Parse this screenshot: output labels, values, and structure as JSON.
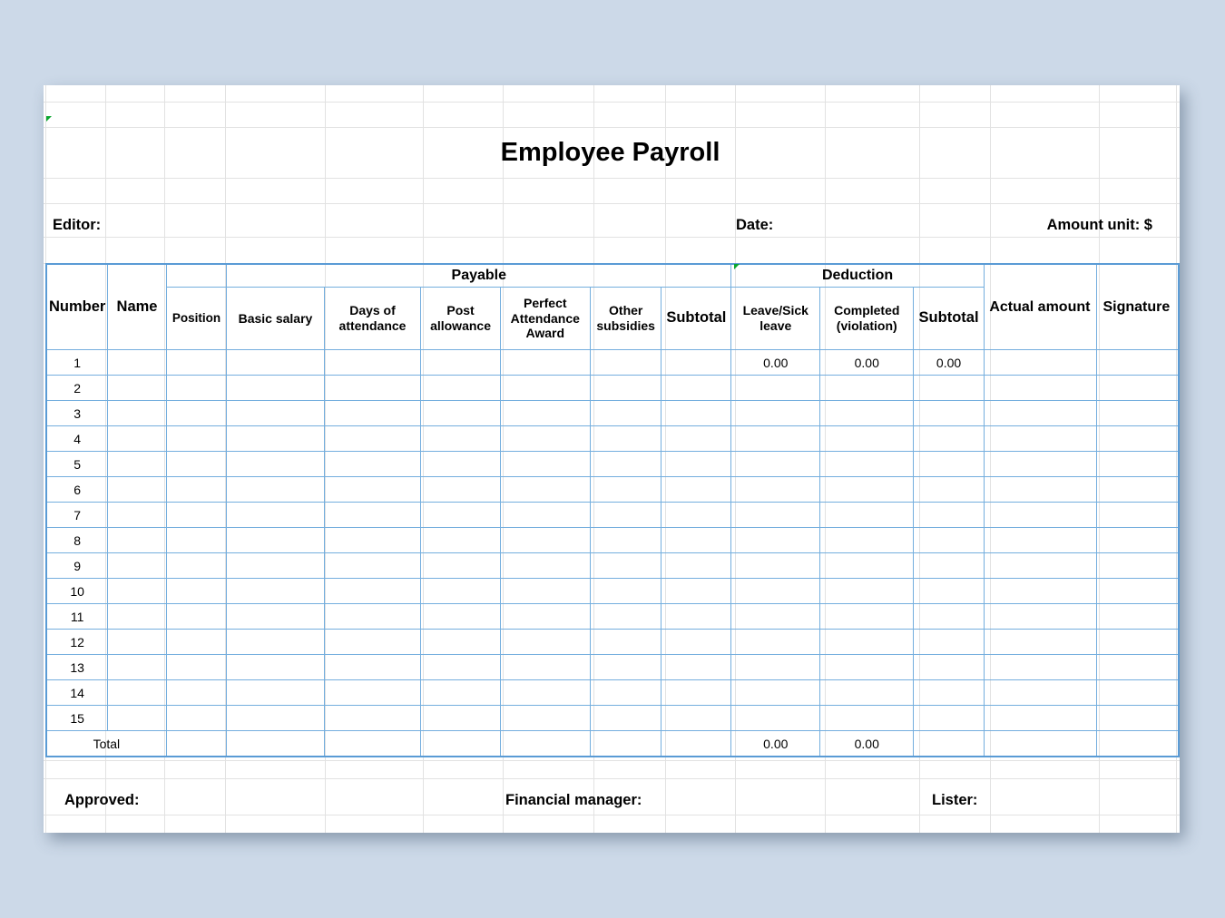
{
  "document": {
    "title": "Employee Payroll"
  },
  "info_row": {
    "editor_label": "Editor:",
    "date_label": "Date:",
    "amount_unit_label": "Amount unit: $"
  },
  "table": {
    "group_headers": {
      "payable": "Payable",
      "deduction": "Deduction"
    },
    "columns": [
      "Number",
      "Name",
      "Position",
      "Basic salary",
      "Days of attendance",
      "Post allowance",
      "Perfect Attendance Award",
      "Other subsidies",
      "Subtotal",
      "Leave/Sick leave",
      "Completed (violation)",
      "Subtotal",
      "Actual amount",
      "Signature"
    ],
    "column_texts": {
      "number": "Number",
      "name": "Name",
      "position": "Position",
      "basic_salary": "Basic salary",
      "days_of_attendance": "Days of attendance",
      "post_allowance": "Post allowance",
      "perfect_attendance_award": "Perfect Attendance Award",
      "other_subsidies": "Other subsidies",
      "payable_subtotal": "Subtotal",
      "leave_sick_leave": "Leave/Sick leave",
      "completed_violation": "Completed (violation)",
      "deduction_subtotal": "Subtotal",
      "actual_amount": "Actual amount",
      "signature": "Signature"
    },
    "rows": [
      {
        "number": "1",
        "name": "",
        "position": "",
        "basic_salary": "",
        "days_of_attendance": "",
        "post_allowance": "",
        "perfect_attendance_award": "",
        "other_subsidies": "",
        "payable_subtotal": "",
        "leave_sick_leave": "0.00",
        "completed_violation": "0.00",
        "deduction_subtotal": "0.00",
        "actual_amount": "",
        "signature": ""
      },
      {
        "number": "2",
        "name": "",
        "position": "",
        "basic_salary": "",
        "days_of_attendance": "",
        "post_allowance": "",
        "perfect_attendance_award": "",
        "other_subsidies": "",
        "payable_subtotal": "",
        "leave_sick_leave": "",
        "completed_violation": "",
        "deduction_subtotal": "",
        "actual_amount": "",
        "signature": ""
      },
      {
        "number": "3",
        "name": "",
        "position": "",
        "basic_salary": "",
        "days_of_attendance": "",
        "post_allowance": "",
        "perfect_attendance_award": "",
        "other_subsidies": "",
        "payable_subtotal": "",
        "leave_sick_leave": "",
        "completed_violation": "",
        "deduction_subtotal": "",
        "actual_amount": "",
        "signature": ""
      },
      {
        "number": "4",
        "name": "",
        "position": "",
        "basic_salary": "",
        "days_of_attendance": "",
        "post_allowance": "",
        "perfect_attendance_award": "",
        "other_subsidies": "",
        "payable_subtotal": "",
        "leave_sick_leave": "",
        "completed_violation": "",
        "deduction_subtotal": "",
        "actual_amount": "",
        "signature": ""
      },
      {
        "number": "5",
        "name": "",
        "position": "",
        "basic_salary": "",
        "days_of_attendance": "",
        "post_allowance": "",
        "perfect_attendance_award": "",
        "other_subsidies": "",
        "payable_subtotal": "",
        "leave_sick_leave": "",
        "completed_violation": "",
        "deduction_subtotal": "",
        "actual_amount": "",
        "signature": ""
      },
      {
        "number": "6",
        "name": "",
        "position": "",
        "basic_salary": "",
        "days_of_attendance": "",
        "post_allowance": "",
        "perfect_attendance_award": "",
        "other_subsidies": "",
        "payable_subtotal": "",
        "leave_sick_leave": "",
        "completed_violation": "",
        "deduction_subtotal": "",
        "actual_amount": "",
        "signature": ""
      },
      {
        "number": "7",
        "name": "",
        "position": "",
        "basic_salary": "",
        "days_of_attendance": "",
        "post_allowance": "",
        "perfect_attendance_award": "",
        "other_subsidies": "",
        "payable_subtotal": "",
        "leave_sick_leave": "",
        "completed_violation": "",
        "deduction_subtotal": "",
        "actual_amount": "",
        "signature": ""
      },
      {
        "number": "8",
        "name": "",
        "position": "",
        "basic_salary": "",
        "days_of_attendance": "",
        "post_allowance": "",
        "perfect_attendance_award": "",
        "other_subsidies": "",
        "payable_subtotal": "",
        "leave_sick_leave": "",
        "completed_violation": "",
        "deduction_subtotal": "",
        "actual_amount": "",
        "signature": ""
      },
      {
        "number": "9",
        "name": "",
        "position": "",
        "basic_salary": "",
        "days_of_attendance": "",
        "post_allowance": "",
        "perfect_attendance_award": "",
        "other_subsidies": "",
        "payable_subtotal": "",
        "leave_sick_leave": "",
        "completed_violation": "",
        "deduction_subtotal": "",
        "actual_amount": "",
        "signature": ""
      },
      {
        "number": "10",
        "name": "",
        "position": "",
        "basic_salary": "",
        "days_of_attendance": "",
        "post_allowance": "",
        "perfect_attendance_award": "",
        "other_subsidies": "",
        "payable_subtotal": "",
        "leave_sick_leave": "",
        "completed_violation": "",
        "deduction_subtotal": "",
        "actual_amount": "",
        "signature": ""
      },
      {
        "number": "11",
        "name": "",
        "position": "",
        "basic_salary": "",
        "days_of_attendance": "",
        "post_allowance": "",
        "perfect_attendance_award": "",
        "other_subsidies": "",
        "payable_subtotal": "",
        "leave_sick_leave": "",
        "completed_violation": "",
        "deduction_subtotal": "",
        "actual_amount": "",
        "signature": ""
      },
      {
        "number": "12",
        "name": "",
        "position": "",
        "basic_salary": "",
        "days_of_attendance": "",
        "post_allowance": "",
        "perfect_attendance_award": "",
        "other_subsidies": "",
        "payable_subtotal": "",
        "leave_sick_leave": "",
        "completed_violation": "",
        "deduction_subtotal": "",
        "actual_amount": "",
        "signature": ""
      },
      {
        "number": "13",
        "name": "",
        "position": "",
        "basic_salary": "",
        "days_of_attendance": "",
        "post_allowance": "",
        "perfect_attendance_award": "",
        "other_subsidies": "",
        "payable_subtotal": "",
        "leave_sick_leave": "",
        "completed_violation": "",
        "deduction_subtotal": "",
        "actual_amount": "",
        "signature": ""
      },
      {
        "number": "14",
        "name": "",
        "position": "",
        "basic_salary": "",
        "days_of_attendance": "",
        "post_allowance": "",
        "perfect_attendance_award": "",
        "other_subsidies": "",
        "payable_subtotal": "",
        "leave_sick_leave": "",
        "completed_violation": "",
        "deduction_subtotal": "",
        "actual_amount": "",
        "signature": ""
      },
      {
        "number": "15",
        "name": "",
        "position": "",
        "basic_salary": "",
        "days_of_attendance": "",
        "post_allowance": "",
        "perfect_attendance_award": "",
        "other_subsidies": "",
        "payable_subtotal": "",
        "leave_sick_leave": "",
        "completed_violation": "",
        "deduction_subtotal": "",
        "actual_amount": "",
        "signature": ""
      }
    ],
    "total_row": {
      "label": "Total",
      "position": "",
      "basic_salary": "",
      "days_of_attendance": "",
      "post_allowance": "",
      "perfect_attendance_award": "",
      "other_subsidies": "",
      "payable_subtotal": "",
      "leave_sick_leave": "0.00",
      "completed_violation": "0.00",
      "deduction_subtotal": "",
      "actual_amount": "",
      "signature": ""
    }
  },
  "footer": {
    "approved_label": "Approved:",
    "financial_manager_label": "Financial manager:",
    "lister_label": "Lister:"
  },
  "colors": {
    "page_background": "#ccd9e8",
    "sheet_background": "#ffffff",
    "table_border": "#74aede",
    "table_outer_border": "#5a9bd5",
    "gridline": "#e2e2e2",
    "marker_green": "#0aa62e",
    "text": "#000000"
  }
}
